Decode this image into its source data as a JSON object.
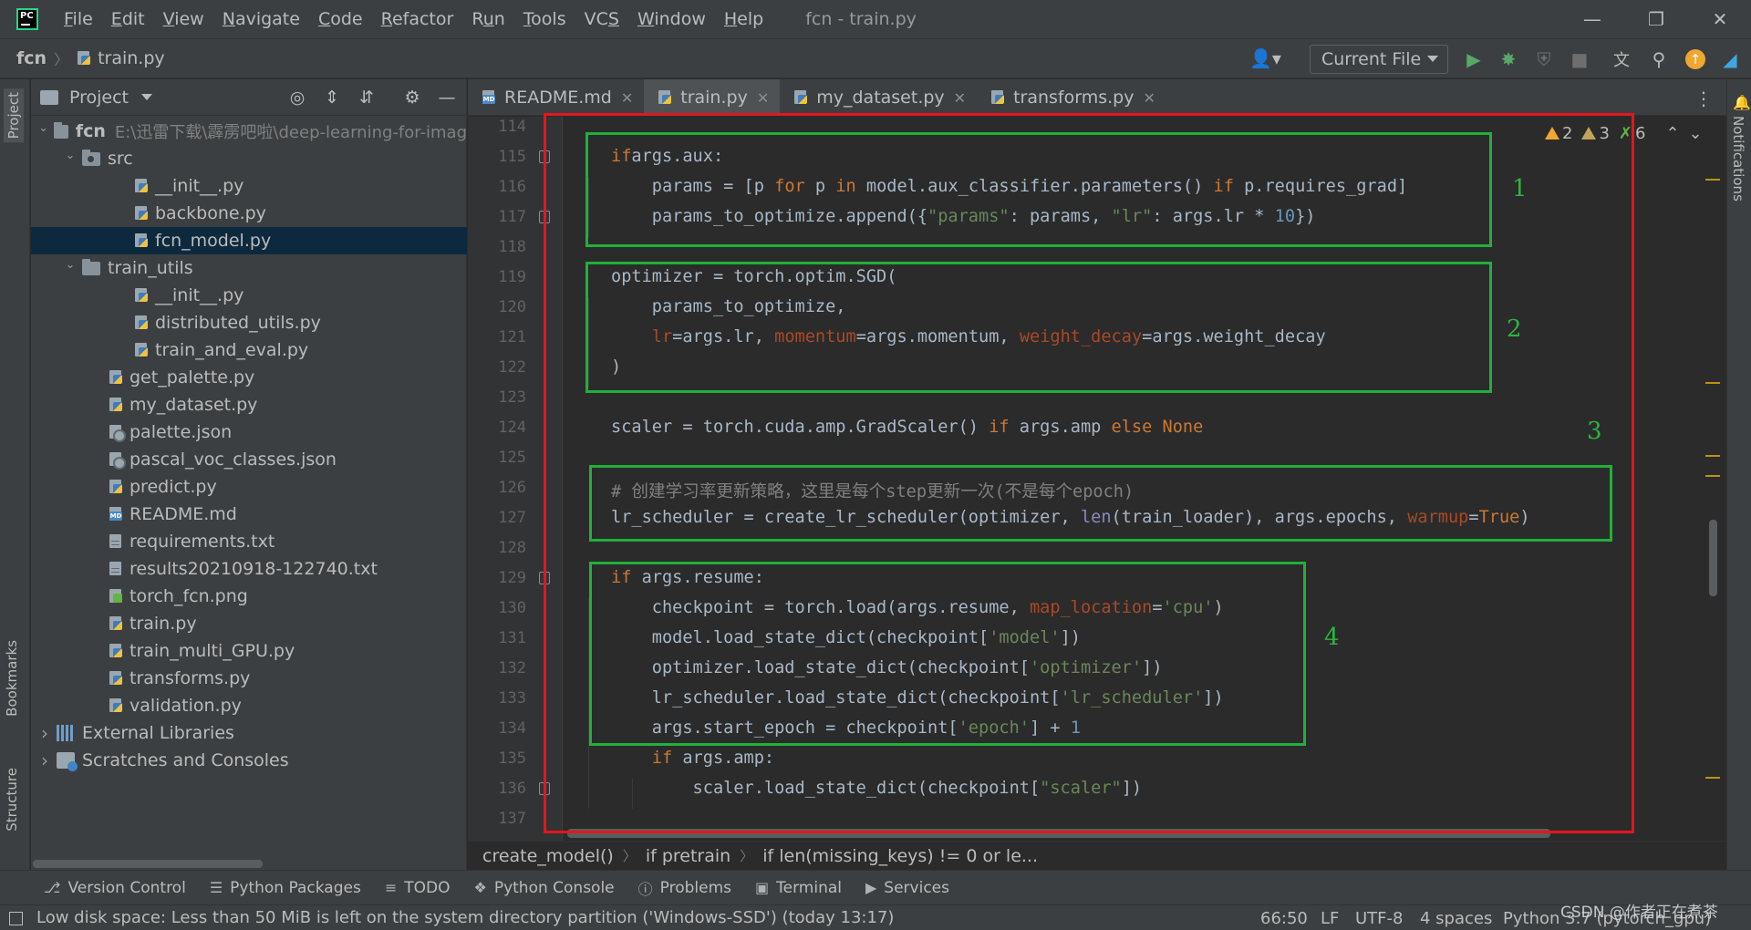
{
  "menubar": {
    "items": [
      {
        "label": "File",
        "u": "F"
      },
      {
        "label": "Edit",
        "u": "E"
      },
      {
        "label": "View",
        "u": "V"
      },
      {
        "label": "Navigate",
        "u": "N"
      },
      {
        "label": "Code",
        "u": "C"
      },
      {
        "label": "Refactor",
        "u": "R"
      },
      {
        "label": "Run",
        "u": "u"
      },
      {
        "label": "Tools",
        "u": "T"
      },
      {
        "label": "VCS",
        "u": "S"
      },
      {
        "label": "Window",
        "u": "W"
      },
      {
        "label": "Help",
        "u": "H"
      }
    ],
    "window_title": "fcn - train.py"
  },
  "navbar": {
    "project": "fcn",
    "file": "train.py",
    "run_config": "Current File"
  },
  "project_panel": {
    "title": "Project",
    "tree": [
      {
        "label": "fcn",
        "hint": "E:\\迅雷下载\\霹雳吧啦\\deep-learning-for-imag",
        "type": "dir",
        "depth": 0,
        "open": true,
        "bold": true
      },
      {
        "label": "src",
        "type": "dir",
        "depth": 1,
        "open": true
      },
      {
        "label": "__init__.py",
        "type": "py",
        "depth": 2
      },
      {
        "label": "backbone.py",
        "type": "py",
        "depth": 2
      },
      {
        "label": "fcn_model.py",
        "type": "py",
        "depth": 2,
        "selected": true
      },
      {
        "label": "train_utils",
        "type": "dir",
        "depth": 1,
        "open": true
      },
      {
        "label": "__init__.py",
        "type": "py",
        "depth": 2
      },
      {
        "label": "distributed_utils.py",
        "type": "py",
        "depth": 2
      },
      {
        "label": "train_and_eval.py",
        "type": "py",
        "depth": 2
      },
      {
        "label": "get_palette.py",
        "type": "py",
        "depth": 1
      },
      {
        "label": "my_dataset.py",
        "type": "py",
        "depth": 1
      },
      {
        "label": "palette.json",
        "type": "json",
        "depth": 1
      },
      {
        "label": "pascal_voc_classes.json",
        "type": "json",
        "depth": 1
      },
      {
        "label": "predict.py",
        "type": "py",
        "depth": 1
      },
      {
        "label": "README.md",
        "type": "md",
        "depth": 1
      },
      {
        "label": "requirements.txt",
        "type": "txt",
        "depth": 1
      },
      {
        "label": "results20210918-122740.txt",
        "type": "txt",
        "depth": 1
      },
      {
        "label": "torch_fcn.png",
        "type": "png",
        "depth": 1
      },
      {
        "label": "train.py",
        "type": "py",
        "depth": 1
      },
      {
        "label": "train_multi_GPU.py",
        "type": "py",
        "depth": 1
      },
      {
        "label": "transforms.py",
        "type": "py",
        "depth": 1
      },
      {
        "label": "validation.py",
        "type": "py",
        "depth": 1
      },
      {
        "label": "External Libraries",
        "type": "lib",
        "depth": 0,
        "open": false
      },
      {
        "label": "Scratches and Consoles",
        "type": "scratch",
        "depth": 0,
        "open": false
      }
    ]
  },
  "left_stripe": {
    "project": "Project",
    "bookmarks": "Bookmarks",
    "structure": "Structure"
  },
  "right_stripe": {
    "notifications": "Notifications"
  },
  "editor": {
    "tabs": [
      {
        "label": "README.md",
        "type": "md"
      },
      {
        "label": "train.py",
        "type": "py",
        "active": true
      },
      {
        "label": "my_dataset.py",
        "type": "py"
      },
      {
        "label": "transforms.py",
        "type": "py"
      }
    ],
    "inspections": {
      "warnings": "2",
      "weak_warnings": "3",
      "typos": "6"
    },
    "line_numbers": [
      "114",
      "115",
      "116",
      "117",
      "118",
      "119",
      "120",
      "121",
      "122",
      "123",
      "124",
      "125",
      "126",
      "127",
      "128",
      "129",
      "130",
      "131",
      "132",
      "133",
      "134",
      "135",
      "136",
      "137"
    ],
    "code": [
      [],
      [
        [
          "kw",
          "if"
        ],
        [
          "",
          "args.aux:"
        ]
      ],
      [
        [
          "",
          "    params = [p "
        ],
        [
          "kw",
          "for"
        ],
        [
          "",
          " p "
        ],
        [
          "kw",
          "in"
        ],
        [
          "",
          " model.aux_classifier.parameters() "
        ],
        [
          "kw",
          "if"
        ],
        [
          "",
          " p.requires_grad]"
        ]
      ],
      [
        [
          "",
          "    params_to_optimize.append({"
        ],
        [
          "str",
          "\"params\""
        ],
        [
          "",
          ": params, "
        ],
        [
          "str",
          "\"lr\""
        ],
        [
          "",
          ": args.lr * "
        ],
        [
          "num",
          "10"
        ],
        [
          "",
          "})"
        ]
      ],
      [],
      [
        [
          "",
          "optimizer = torch.optim.SGD("
        ]
      ],
      [
        [
          "",
          "    params_to_optimize,"
        ]
      ],
      [
        [
          "",
          "    "
        ],
        [
          "prm",
          "lr"
        ],
        [
          "",
          "=args.lr, "
        ],
        [
          "prm",
          "momentum"
        ],
        [
          "",
          "=args.momentum, "
        ],
        [
          "prm",
          "weight_decay"
        ],
        [
          "",
          "=args.weight_decay"
        ]
      ],
      [
        [
          "",
          ")"
        ]
      ],
      [],
      [
        [
          "",
          "scaler = torch.cuda.amp.GradScaler() "
        ],
        [
          "kw",
          "if"
        ],
        [
          "",
          " args.amp "
        ],
        [
          "kw",
          "else"
        ],
        [
          "",
          " "
        ],
        [
          "kw",
          "None"
        ]
      ],
      [],
      [
        [
          "cmt",
          "# 创建学习率更新策略，这里是每个step更新一次(不是每个epoch)"
        ]
      ],
      [
        [
          "",
          "lr_scheduler = create_lr_scheduler(optimizer, "
        ],
        [
          "fn",
          "len"
        ],
        [
          "",
          "(train_loader), args.epochs, "
        ],
        [
          "prm",
          "warmup"
        ],
        [
          "",
          "="
        ],
        [
          "kw",
          "True"
        ],
        [
          "",
          ")"
        ]
      ],
      [],
      [
        [
          "kw",
          "if"
        ],
        [
          "",
          " args.resume:"
        ]
      ],
      [
        [
          "",
          "    checkpoint = torch.load(args.resume, "
        ],
        [
          "prm",
          "map_location"
        ],
        [
          "",
          "="
        ],
        [
          "str",
          "'cpu'"
        ],
        [
          "",
          ")"
        ]
      ],
      [
        [
          "",
          "    model.load_state_dict(checkpoint["
        ],
        [
          "str",
          "'model'"
        ],
        [
          "",
          "])"
        ]
      ],
      [
        [
          "",
          "    optimizer.load_state_dict(checkpoint["
        ],
        [
          "str",
          "'optimizer'"
        ],
        [
          "",
          "])"
        ]
      ],
      [
        [
          "",
          "    lr_scheduler.load_state_dict(checkpoint["
        ],
        [
          "str",
          "'lr_scheduler'"
        ],
        [
          "",
          "])"
        ]
      ],
      [
        [
          "",
          "    args.start_epoch = checkpoint["
        ],
        [
          "str",
          "'epoch'"
        ],
        [
          "",
          "] + "
        ],
        [
          "num",
          "1"
        ]
      ],
      [
        [
          "",
          "    "
        ],
        [
          "kw",
          "if"
        ],
        [
          "",
          " args.amp:"
        ]
      ],
      [
        [
          "",
          "        scaler.load_state_dict(checkpoint["
        ],
        [
          "str",
          "\"scaler\""
        ],
        [
          "",
          "])"
        ]
      ],
      []
    ],
    "annotations": [
      "1",
      "2",
      "3",
      "4"
    ]
  },
  "code_breadcrumbs": [
    "create_model()",
    "if pretrain",
    "if len(missing_keys) != 0 or le..."
  ],
  "tool_windows": [
    {
      "label": "Version Control",
      "icon": "branch-icon"
    },
    {
      "label": "Python Packages",
      "icon": "layers-icon"
    },
    {
      "label": "TODO",
      "icon": "list-icon"
    },
    {
      "label": "Python Console",
      "icon": "python-icon"
    },
    {
      "label": "Problems",
      "icon": "info-icon"
    },
    {
      "label": "Terminal",
      "icon": "terminal-icon"
    },
    {
      "label": "Services",
      "icon": "play-circle-icon"
    }
  ],
  "statusbar": {
    "message": "Low disk space: Less than 50 MiB is left on the system directory partition ('Windows-SSD') (today 13:17)",
    "position": "66:50",
    "line_sep": "LF",
    "encoding": "UTF-8",
    "indent": "4 spaces",
    "interpreter": "Python 3.7 (pytorch_gpu)"
  },
  "watermark": "CSDN @作者正在煮茶",
  "colors": {
    "red_box": "#e3161e",
    "green_box": "#21b03a",
    "annotation_text": "#2cb53f"
  }
}
